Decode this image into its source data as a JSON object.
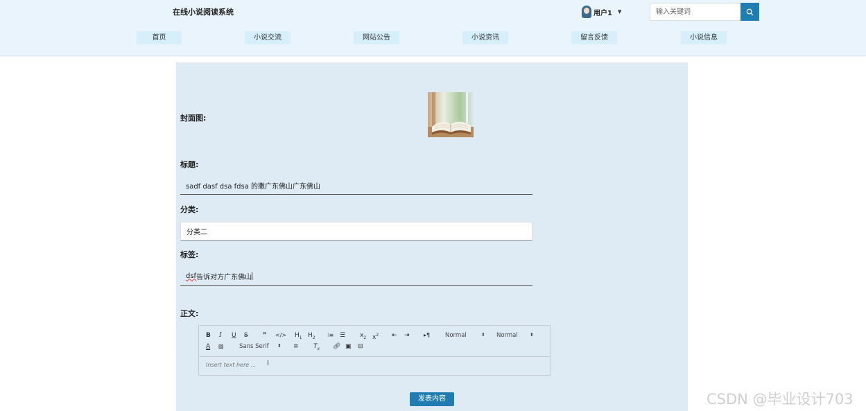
{
  "header": {
    "site_title": "在线小说阅读系统",
    "user_name": "用户1",
    "search_placeholder": "输入关键词",
    "accent_color": "#1f7db2"
  },
  "nav": {
    "items": [
      {
        "label": "首页"
      },
      {
        "label": "小说交流"
      },
      {
        "label": "网站公告"
      },
      {
        "label": "小说资讯"
      },
      {
        "label": "留言反馈"
      },
      {
        "label": "小说信息"
      }
    ]
  },
  "form": {
    "cover_label": "封面图:",
    "title_label": "标题:",
    "title_value": "sadf dasf dsa fdsa 的撒广东佛山广东佛山",
    "category_label": "分类:",
    "category_value": "分类二",
    "tags_label": "标签:",
    "tags_value_misspelled": "dsf",
    "tags_value_rest": " 告诉对方广东佛山",
    "content_label": "正文:",
    "submit_label": "发表内容"
  },
  "editor": {
    "header_select": "Normal",
    "size_select": "Normal",
    "font_select": "Sans Serif",
    "placeholder": "Insert text here ..."
  },
  "watermark": "CSDN @毕业设计703"
}
